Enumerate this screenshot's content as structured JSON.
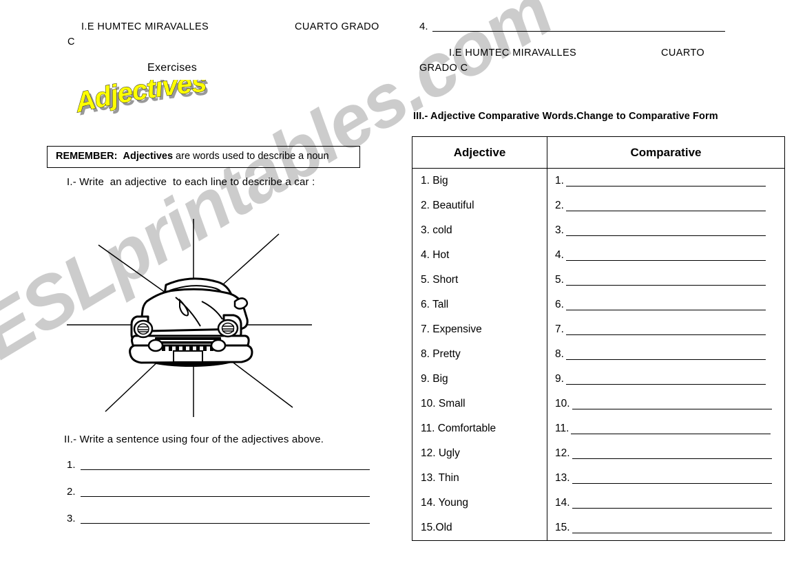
{
  "watermark": {
    "text": "ESLprintables.com",
    "color": "#cccccc"
  },
  "left": {
    "header": {
      "school": "I.E HUMTEC MIRAVALLES",
      "grade": "CUARTO GRADO",
      "grade_cont": "C"
    },
    "exercises_label": "Exercises",
    "title": "Adjectives",
    "title_color": "#ffff00",
    "remember": {
      "label": "REMEMBER:",
      "keyword": "Adjectives",
      "rest": " are words used to describe a noun"
    },
    "instruction_1": "I.- Write  an adjective  to each line to describe a car :",
    "car_icon": "car-front-clipart",
    "instruction_2": "II.- Write a sentence using four of the adjectives above.",
    "answer_numbers": [
      "1.",
      "2.",
      "3."
    ]
  },
  "right": {
    "continued_answer_number": "4.",
    "header": {
      "school": "I.E HUMTEC MIRAVALLES",
      "grade": "CUARTO",
      "grade_cont": "GRADO C"
    },
    "section_title": "III.- Adjective Comparative Words.Change to Comparative Form",
    "table": {
      "columns": [
        "Adjective",
        "Comparative"
      ],
      "rows": [
        {
          "adjective": "1. Big",
          "number": "1."
        },
        {
          "adjective": "2. Beautiful",
          "number": "2."
        },
        {
          "adjective": "3. cold",
          "number": "3."
        },
        {
          "adjective": "4. Hot",
          "number": "4."
        },
        {
          "adjective": "5. Short",
          "number": "5."
        },
        {
          "adjective": "6. Tall",
          "number": "6."
        },
        {
          "adjective": "7. Expensive",
          "number": "7."
        },
        {
          "adjective": "8. Pretty",
          "number": "8."
        },
        {
          "adjective": "9. Big",
          "number": "9."
        },
        {
          "adjective": "10. Small",
          "number": "10."
        },
        {
          "adjective": "11. Comfortable",
          "number": "11."
        },
        {
          "adjective": "12. Ugly",
          "number": "12."
        },
        {
          "adjective": "13. Thin",
          "number": "13."
        },
        {
          "adjective": "14. Young",
          "number": "14."
        },
        {
          "adjective": "15.Old",
          "number": "15."
        }
      ]
    }
  }
}
